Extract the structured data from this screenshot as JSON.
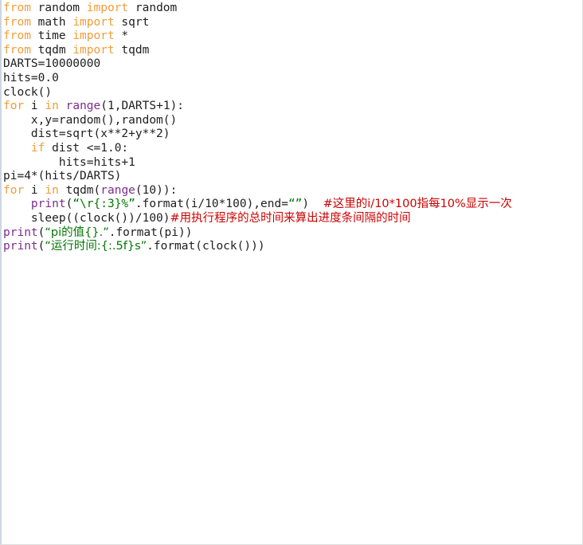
{
  "document": {
    "kind": "python-source-listing",
    "language": "Python",
    "background_color": "#ffffff",
    "border_color": "#dedede"
  },
  "colors": {
    "keyword": "#f29d38",
    "builtin": "#7b2d8e",
    "string": "#057605",
    "comment": "#cc0000",
    "plain": "#202020",
    "gutter_rule": "#cdd6e0"
  },
  "code": {
    "lines": [
      {
        "n": 1,
        "tokens": [
          {
            "t": "from",
            "c": "kw"
          },
          {
            "t": " random ",
            "c": "plain"
          },
          {
            "t": "import",
            "c": "kw"
          },
          {
            "t": " random",
            "c": "plain"
          }
        ]
      },
      {
        "n": 2,
        "tokens": [
          {
            "t": "from",
            "c": "kw"
          },
          {
            "t": " math ",
            "c": "plain"
          },
          {
            "t": "import",
            "c": "kw"
          },
          {
            "t": " sqrt",
            "c": "plain"
          }
        ]
      },
      {
        "n": 3,
        "tokens": [
          {
            "t": "from",
            "c": "kw"
          },
          {
            "t": " time ",
            "c": "plain"
          },
          {
            "t": "import",
            "c": "kw"
          },
          {
            "t": " *",
            "c": "plain"
          }
        ]
      },
      {
        "n": 4,
        "tokens": [
          {
            "t": "from",
            "c": "kw"
          },
          {
            "t": " tqdm ",
            "c": "plain"
          },
          {
            "t": "import",
            "c": "kw"
          },
          {
            "t": " tqdm",
            "c": "plain"
          }
        ]
      },
      {
        "n": 5,
        "tokens": [
          {
            "t": "DARTS=10000000",
            "c": "plain"
          }
        ]
      },
      {
        "n": 6,
        "tokens": [
          {
            "t": "hits=0.0",
            "c": "plain"
          }
        ]
      },
      {
        "n": 7,
        "tokens": [
          {
            "t": "clock()",
            "c": "plain"
          }
        ]
      },
      {
        "n": 8,
        "tokens": [
          {
            "t": "for",
            "c": "kw"
          },
          {
            "t": " i ",
            "c": "plain"
          },
          {
            "t": "in",
            "c": "kw"
          },
          {
            "t": " ",
            "c": "plain"
          },
          {
            "t": "range",
            "c": "bfn"
          },
          {
            "t": "(1,DARTS+1):",
            "c": "plain"
          }
        ]
      },
      {
        "n": 9,
        "tokens": [
          {
            "t": "    x,y=random(),random()",
            "c": "plain"
          }
        ]
      },
      {
        "n": 10,
        "tokens": [
          {
            "t": "    dist=sqrt(x**2+y**2)",
            "c": "plain"
          }
        ]
      },
      {
        "n": 11,
        "tokens": [
          {
            "t": "    ",
            "c": "plain"
          },
          {
            "t": "if",
            "c": "kw"
          },
          {
            "t": " dist <=1.0:",
            "c": "plain"
          }
        ]
      },
      {
        "n": 12,
        "tokens": [
          {
            "t": "        hits=hits+1",
            "c": "plain"
          }
        ]
      },
      {
        "n": 13,
        "tokens": [
          {
            "t": "pi=4*(hits/DARTS)",
            "c": "plain"
          }
        ]
      },
      {
        "n": 14,
        "tokens": [
          {
            "t": "for",
            "c": "kw"
          },
          {
            "t": " i ",
            "c": "plain"
          },
          {
            "t": "in",
            "c": "kw"
          },
          {
            "t": " tqdm(",
            "c": "plain"
          },
          {
            "t": "range",
            "c": "bfn"
          },
          {
            "t": "(10)):",
            "c": "plain"
          }
        ]
      },
      {
        "n": 15,
        "tokens": [
          {
            "t": "    ",
            "c": "plain"
          },
          {
            "t": "print",
            "c": "bfn"
          },
          {
            "t": "(",
            "c": "plain"
          },
          {
            "t": "“\\r{:3}%”",
            "c": "str"
          },
          {
            "t": ".format(i/10*100),end=",
            "c": "plain"
          },
          {
            "t": "“”",
            "c": "str"
          },
          {
            "t": ")  ",
            "c": "plain"
          },
          {
            "t": "#这里的i/10*100指每10%显示一次",
            "c": "com"
          }
        ]
      },
      {
        "n": 16,
        "tokens": [
          {
            "t": "    sleep((clock())/100)",
            "c": "plain"
          },
          {
            "t": "#用执行程序的总时间来算出进度条间隔的时间",
            "c": "com"
          }
        ]
      },
      {
        "n": 17,
        "tokens": [
          {
            "t": "print",
            "c": "bfn"
          },
          {
            "t": "(",
            "c": "plain"
          },
          {
            "t": "“pi的值{}.”",
            "c": "str"
          },
          {
            "t": ".format(pi))",
            "c": "plain"
          }
        ]
      },
      {
        "n": 18,
        "tokens": [
          {
            "t": "print",
            "c": "bfn"
          },
          {
            "t": "(",
            "c": "plain"
          },
          {
            "t": "“运行时间:{:.5f}s”",
            "c": "str"
          },
          {
            "t": ".format(clock()))",
            "c": "plain"
          }
        ]
      }
    ]
  }
}
